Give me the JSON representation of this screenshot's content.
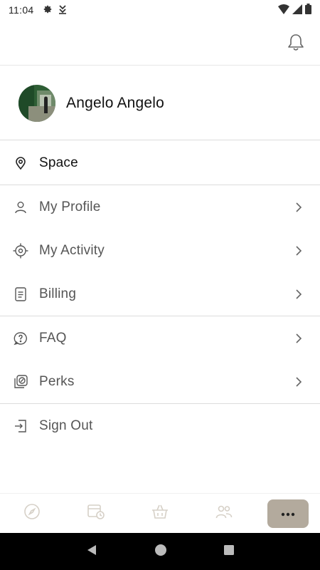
{
  "status_bar": {
    "time": "11:04",
    "icons_left": [
      "gear-icon",
      "download-icon"
    ],
    "icons_right": [
      "wifi-icon",
      "signal-icon",
      "battery-icon"
    ]
  },
  "top_bar": {
    "icon": "bell-icon"
  },
  "profile": {
    "name": "Angelo Angelo",
    "avatar": "profile-photo"
  },
  "menu": {
    "space": {
      "label": "Space",
      "icon": "location-pin-icon"
    },
    "groups": [
      [
        {
          "label": "My Profile",
          "icon": "user-icon"
        },
        {
          "label": "My Activity",
          "icon": "crosshair-icon"
        },
        {
          "label": "Billing",
          "icon": "document-icon"
        }
      ],
      [
        {
          "label": "FAQ",
          "icon": "help-bubble-icon"
        },
        {
          "label": "Perks",
          "icon": "discount-tag-icon"
        }
      ]
    ],
    "sign_out": {
      "label": "Sign Out",
      "icon": "sign-out-icon"
    }
  },
  "bottom_nav": {
    "items": [
      "compass-icon",
      "calendar-clock-icon",
      "basket-icon",
      "people-icon",
      "more-icon"
    ],
    "active": "more-icon"
  },
  "colors": {
    "accent": "#b3aa9d",
    "divider": "#dcdcdc",
    "icon": "#444444",
    "nav_inactive": "#d6d0c7"
  }
}
